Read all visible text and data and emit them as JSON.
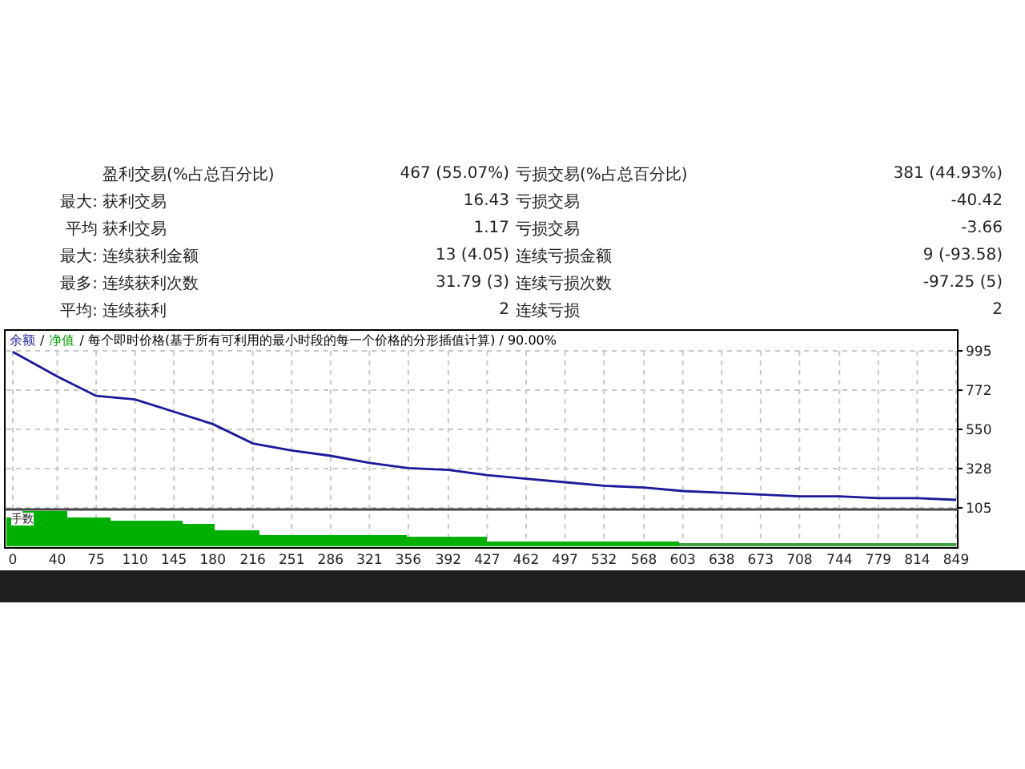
{
  "stats": [
    {
      "label": "盈利交易(%占总百分比)",
      "value": "467 (55.07%)",
      "label2": "亏损交易(%占总百分比)",
      "value2": "381 (44.93%)"
    },
    {
      "prefix": "最大:",
      "label": "获利交易",
      "value": "16.43",
      "label2": "亏损交易",
      "value2": "-40.42"
    },
    {
      "prefix": "平均",
      "label": "获利交易",
      "value": "1.17",
      "label2": "亏损交易",
      "value2": "-3.66"
    },
    {
      "prefix": "最大:",
      "label": "连续获利金额",
      "value": "13 (4.05)",
      "label2": "连续亏损金额",
      "value2": "9 (-93.58)"
    },
    {
      "prefix": "最多:",
      "label": "连续获利次数",
      "value": "31.79 (3)",
      "label2": "连续亏损次数",
      "value2": "-97.25 (5)"
    },
    {
      "prefix": "平均:",
      "label": "连续获利",
      "value": "2",
      "label2": "连续亏损",
      "value2": "2"
    }
  ],
  "chart": {
    "legend": [
      {
        "text": "/",
        "color": "#000000"
      },
      {
        "text": "净值",
        "color": "#00a000"
      },
      {
        "text": "/ 每个即时价格(基于所有可利用的最小时段的每一个价格的分形插值计算) / 90.00%",
        "color": "#000000"
      }
    ],
    "volume_label": "手数",
    "chart_data": {
      "type": "line",
      "grid": true,
      "x": [
        0,
        40,
        75,
        110,
        145,
        180,
        216,
        251,
        286,
        321,
        356,
        392,
        427,
        462,
        497,
        532,
        568,
        603,
        638,
        673,
        708,
        744,
        779,
        814,
        849
      ],
      "series": [
        {
          "name": "余额",
          "color": "#1a1a9a",
          "values": [
            990,
            850,
            740,
            720,
            650,
            580,
            470,
            430,
            400,
            360,
            330,
            320,
            290,
            270,
            250,
            230,
            220,
            200,
            190,
            180,
            170,
            170,
            160,
            160,
            150
          ]
        }
      ],
      "xticks": [
        0,
        40,
        75,
        110,
        145,
        180,
        216,
        251,
        286,
        321,
        356,
        392,
        427,
        462,
        497,
        532,
        568,
        603,
        638,
        673,
        708,
        744,
        779,
        814,
        849
      ],
      "yticks": [
        105,
        328,
        550,
        772,
        995
      ],
      "xlim": [
        0,
        849
      ],
      "ylim": [
        105,
        995
      ]
    }
  }
}
